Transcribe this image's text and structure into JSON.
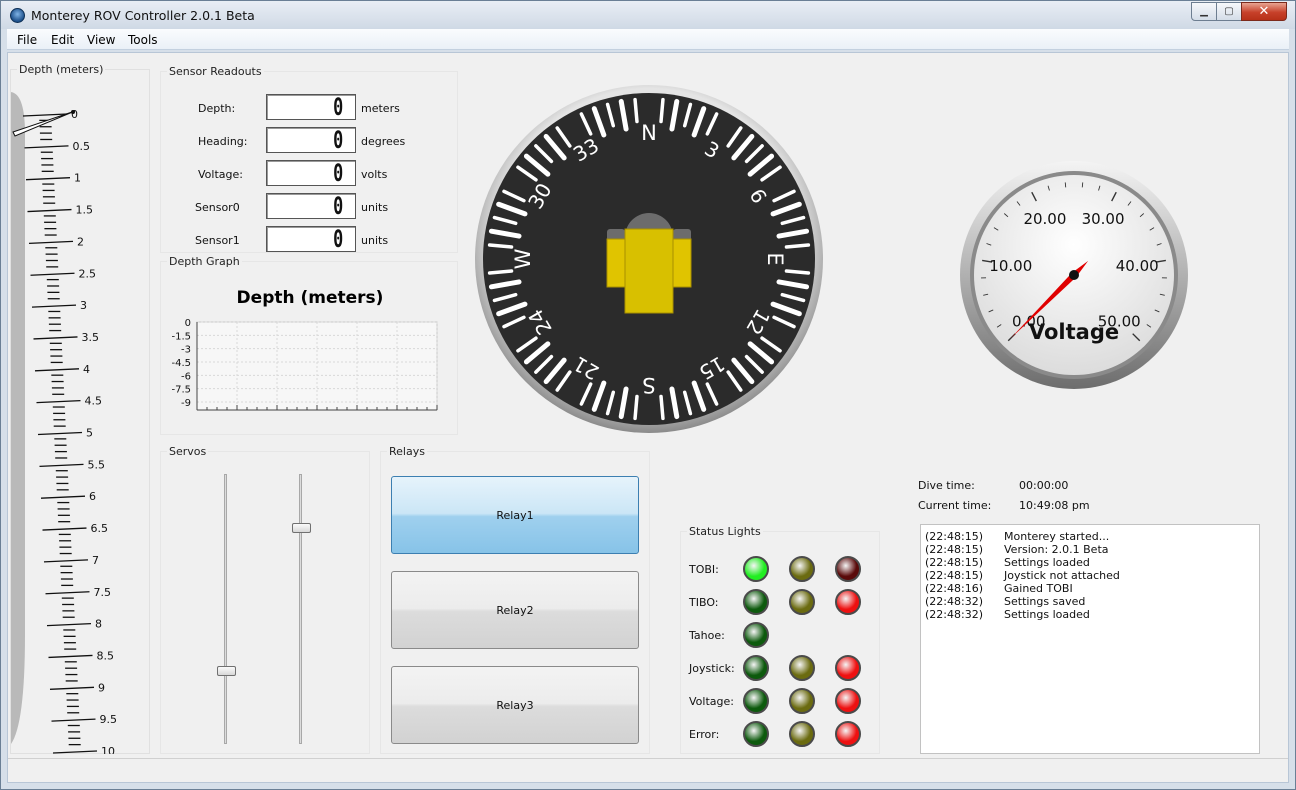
{
  "window": {
    "title": "Monterey ROV Controller 2.0.1 Beta"
  },
  "menu": [
    "File",
    "Edit",
    "View",
    "Tools"
  ],
  "depth_gauge": {
    "title": "Depth (meters)",
    "ticks": [
      "0",
      "0.5",
      "1",
      "1.5",
      "2",
      "2.5",
      "3",
      "3.5",
      "4",
      "4.5",
      "5",
      "5.5",
      "6",
      "6.5",
      "7",
      "7.5",
      "8",
      "8.5",
      "9",
      "9.5",
      "10"
    ],
    "value": 0
  },
  "sensors": {
    "title": "Sensor Readouts",
    "rows": [
      {
        "label": "Depth:",
        "value": "0",
        "unit": "meters"
      },
      {
        "label": "Heading:",
        "value": "0",
        "unit": "degrees"
      },
      {
        "label": "Voltage:",
        "value": "0",
        "unit": "volts"
      },
      {
        "label": "Sensor0",
        "value": "0",
        "unit": "units"
      },
      {
        "label": "Sensor1",
        "value": "0",
        "unit": "units"
      }
    ]
  },
  "depth_graph": {
    "title": "Depth Graph",
    "chart_title": "Depth (meters)",
    "yticks": [
      "0",
      "-1.5",
      "-3",
      "-4.5",
      "-6",
      "-7.5",
      "-9"
    ]
  },
  "compass": {
    "labels": [
      "N",
      "3",
      "6",
      "E",
      "12",
      "15",
      "S",
      "21",
      "24",
      "W",
      "30",
      "33"
    ],
    "heading": 0
  },
  "voltage_gauge": {
    "labels": [
      "0.00",
      "10.00",
      "20.00",
      "30.00",
      "40.00",
      "50.00"
    ],
    "title": "Voltage",
    "value": 0,
    "accent": "#e00000"
  },
  "servos": {
    "title": "Servos",
    "values": [
      0.27,
      0.8
    ]
  },
  "relays": {
    "title": "Relays",
    "items": [
      {
        "label": "Relay1",
        "on": true
      },
      {
        "label": "Relay2",
        "on": false
      },
      {
        "label": "Relay3",
        "on": false
      }
    ]
  },
  "status_lights": {
    "title": "Status Lights",
    "rows": [
      {
        "label": "TOBI:",
        "colors": [
          "#22ee22",
          "#6b6b10",
          "#5a0a0a"
        ]
      },
      {
        "label": "TIBO:",
        "colors": [
          "#0d5a0d",
          "#6b6b10",
          "#ee1111"
        ]
      },
      {
        "label": "Tahoe:",
        "colors": [
          "#0d5a0d"
        ]
      },
      {
        "label": "Joystick:",
        "colors": [
          "#0d5a0d",
          "#6b6b10",
          "#ee1111"
        ]
      },
      {
        "label": "Voltage:",
        "colors": [
          "#0d5a0d",
          "#6b6b10",
          "#ee1111"
        ]
      },
      {
        "label": "Error:",
        "colors": [
          "#0d5a0d",
          "#6b6b10",
          "#ee1111"
        ]
      }
    ]
  },
  "times": {
    "dive_label": "Dive time:",
    "dive_value": "00:00:00",
    "current_label": "Current time:",
    "current_value": "10:49:08 pm"
  },
  "log": [
    {
      "t": "(22:48:15)",
      "m": "Monterey started..."
    },
    {
      "t": "(22:48:15)",
      "m": "Version: 2.0.1 Beta"
    },
    {
      "t": "(22:48:15)",
      "m": "Settings loaded"
    },
    {
      "t": "(22:48:15)",
      "m": "Joystick not attached"
    },
    {
      "t": "(22:48:16)",
      "m": "Gained TOBI"
    },
    {
      "t": "(22:48:32)",
      "m": "Settings saved"
    },
    {
      "t": "(22:48:32)",
      "m": "Settings loaded"
    }
  ]
}
